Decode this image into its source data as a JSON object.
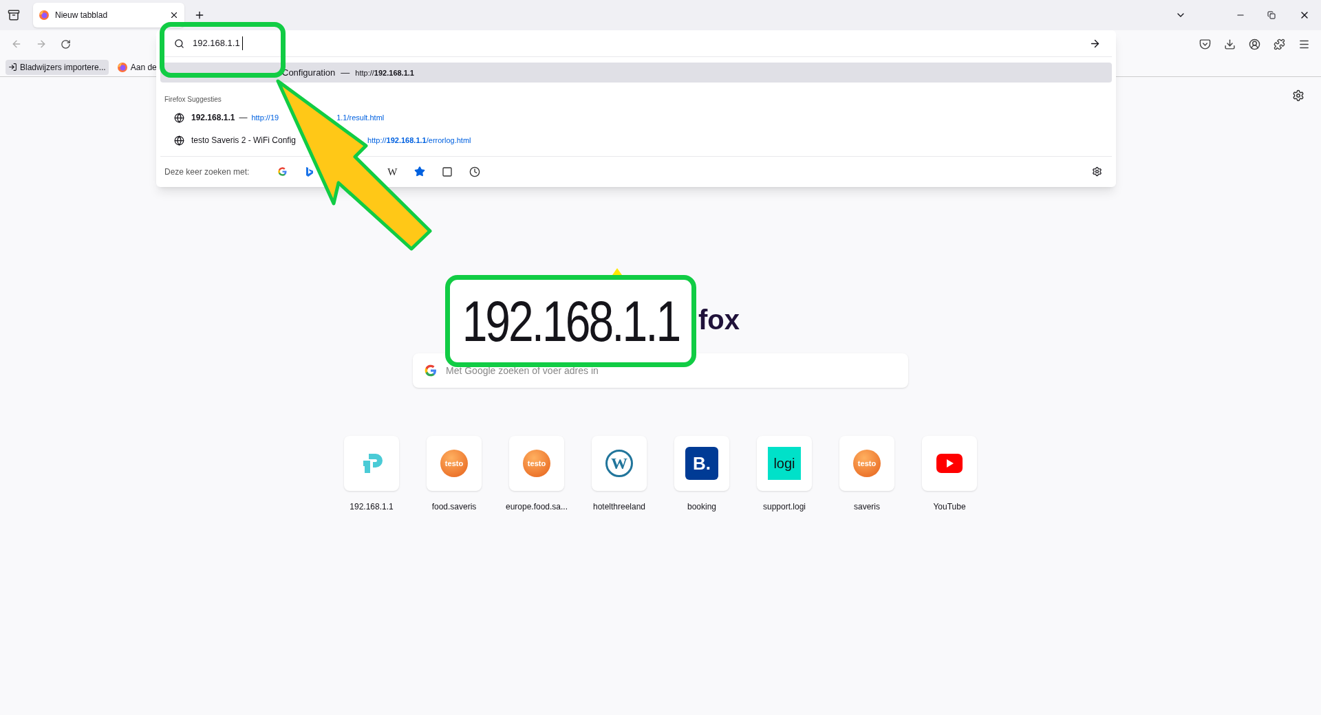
{
  "tab": {
    "title": "Nieuw tabblad",
    "selected": true
  },
  "bookmarks": [
    {
      "kind": "import",
      "label": "Bladwijzers importere..."
    },
    {
      "kind": "firefox",
      "label": "Aan de"
    }
  ],
  "urlbar": {
    "value": "192.168.1.1"
  },
  "dropdown": {
    "top_row": {
      "title": "Configuration",
      "dash": "—",
      "url": "http://**192.168.1.1**",
      "selected": true
    },
    "section": "Firefox Suggesties",
    "suggestions": [
      {
        "parts": [
          "**192.168.1.1**",
          "—"
        ],
        "url_parts": [
          "http://19",
          "1.1/result.html"
        ]
      },
      {
        "parts": [
          "testo Saveris 2 - WiFi Config"
        ],
        "url_parts": [
          "http://**192.168.1.1**/errorlog.html"
        ]
      }
    ],
    "search_with": "Deze keer zoeken met:",
    "engines": [
      {
        "kind": "google"
      },
      {
        "kind": "bing"
      },
      {
        "kind": "hidden"
      },
      {
        "kind": "hidden"
      },
      {
        "kind": "wikipedia",
        "glyph": "W"
      },
      {
        "kind": "bookmarks"
      },
      {
        "kind": "tabs"
      },
      {
        "kind": "history"
      }
    ]
  },
  "logo_text": "fox",
  "callout": "192.168.1.1",
  "search": {
    "placeholder": "Met Google zoeken of voer adres in"
  },
  "shortcuts": [
    {
      "kind": "tplink",
      "label": "192.168.1.1"
    },
    {
      "kind": "testo",
      "badge": "testo",
      "label": "food.saveris"
    },
    {
      "kind": "testo",
      "badge": "testo",
      "label": "europe.food.sa..."
    },
    {
      "kind": "wordpress",
      "badge": "W",
      "label": "hotelthreeland"
    },
    {
      "kind": "booking",
      "badge": "B.",
      "label": "booking"
    },
    {
      "kind": "logi",
      "badge": "logi",
      "label": "support.logi"
    },
    {
      "kind": "testo",
      "badge": "testo",
      "label": "saveris"
    },
    {
      "kind": "youtube",
      "label": "YouTube"
    }
  ]
}
